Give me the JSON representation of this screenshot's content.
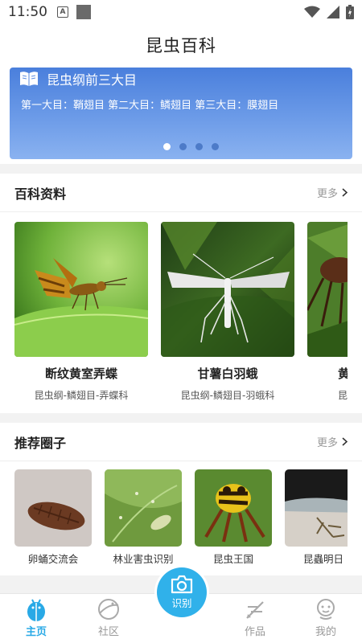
{
  "status_bar": {
    "time": "11:50",
    "app_badge": "A"
  },
  "header": {
    "title": "昆虫百科"
  },
  "banner": {
    "title": "昆虫纲前三大目",
    "description": "第一大目：鞘翅目 第二大目：鳞翅目 第三大目：膜翅目",
    "dot_count": 4,
    "active_dot": 0
  },
  "encyclopedia": {
    "title": "百科资料",
    "more": "更多",
    "cards": [
      {
        "name": "断纹黄室弄蝶",
        "classification": "昆虫纲-鳞翅目-弄蝶科"
      },
      {
        "name": "甘薯白羽蛾",
        "classification": "昆虫纲-鳞翅目-羽蛾科"
      },
      {
        "name": "黄",
        "classification": "昆"
      }
    ]
  },
  "circles": {
    "title": "推荐圈子",
    "more": "更多",
    "items": [
      {
        "label": "卵蛹交流会"
      },
      {
        "label": "林业害虫识别"
      },
      {
        "label": "昆虫王国"
      },
      {
        "label": "昆蟲明日"
      }
    ]
  },
  "bottom_nav": {
    "items": [
      {
        "label": "主页",
        "icon": "bug-icon",
        "active": true
      },
      {
        "label": "社区",
        "icon": "planet-icon",
        "active": false
      },
      {
        "label": "识别",
        "icon": "camera-icon",
        "active": false
      },
      {
        "label": "作品",
        "icon": "pen-icon",
        "active": false
      },
      {
        "label": "我的",
        "icon": "profile-icon",
        "active": false
      }
    ]
  },
  "colors": {
    "accent": "#30b1ea",
    "banner": "#5b8de3",
    "muted": "#999999"
  }
}
